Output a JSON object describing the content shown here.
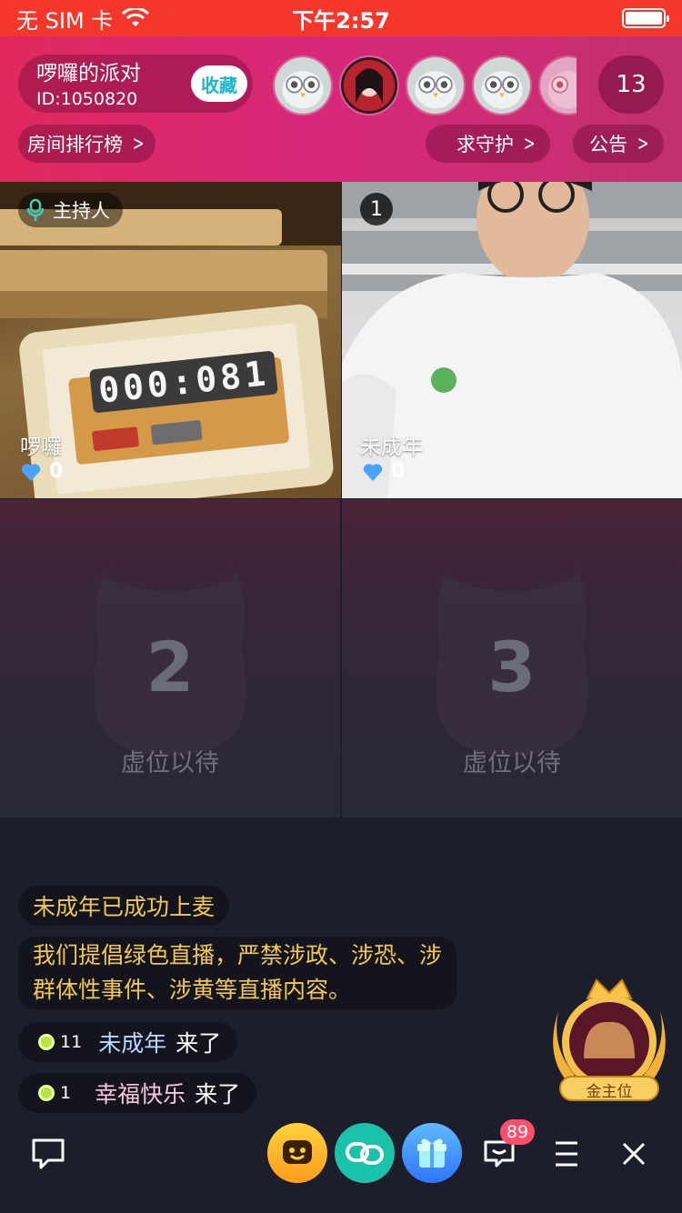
{
  "status_bar": {
    "carrier": "无 SIM 卡",
    "time": "下午2:57"
  },
  "header": {
    "room_title": "啰囉的派对",
    "room_id": "ID:1050820",
    "favorite_label": "收藏",
    "online_count": "13",
    "ranking_label": "房间排行榜",
    "guard_label": "求守护",
    "notice_label": "公告"
  },
  "seats": {
    "host": {
      "badge": "主持人",
      "name": "啰囉",
      "hearts": "0"
    },
    "seat1": {
      "number": "1",
      "name": "未成年",
      "hearts": "0"
    },
    "seat2": {
      "number": "2",
      "label": "虚位以待"
    },
    "seat3": {
      "number": "3",
      "label": "虚位以待"
    }
  },
  "host_video_timer": "000:081",
  "chat": {
    "system_line": "未成年已成功上麦",
    "notice_line1": "我们提倡绿色直播，严禁涉政、涉恐、涉",
    "notice_line2": "群体性事件、涉黄等直播内容。",
    "entries": [
      {
        "level": "11",
        "name": "未成年",
        "action": "来了"
      },
      {
        "level": "1",
        "name": "幸福快乐",
        "action": "来了"
      }
    ]
  },
  "gold_seat_label": "金主位",
  "bottom_bar": {
    "message_badge": "89"
  },
  "colors": {
    "accent_red": "#f4372a",
    "header_pink": "#d8287a",
    "notice_gold": "#f2c94c",
    "favorite_teal": "#1ab6c9"
  },
  "icons": [
    "wifi-icon",
    "battery-icon",
    "microphone-icon",
    "heart-icon",
    "chevron-right-icon",
    "owl-placeholder-icon",
    "chat-bubble-icon",
    "emoji-icon",
    "link-icon",
    "gift-icon",
    "message-icon",
    "menu-icon",
    "close-icon",
    "crown-icon"
  ]
}
